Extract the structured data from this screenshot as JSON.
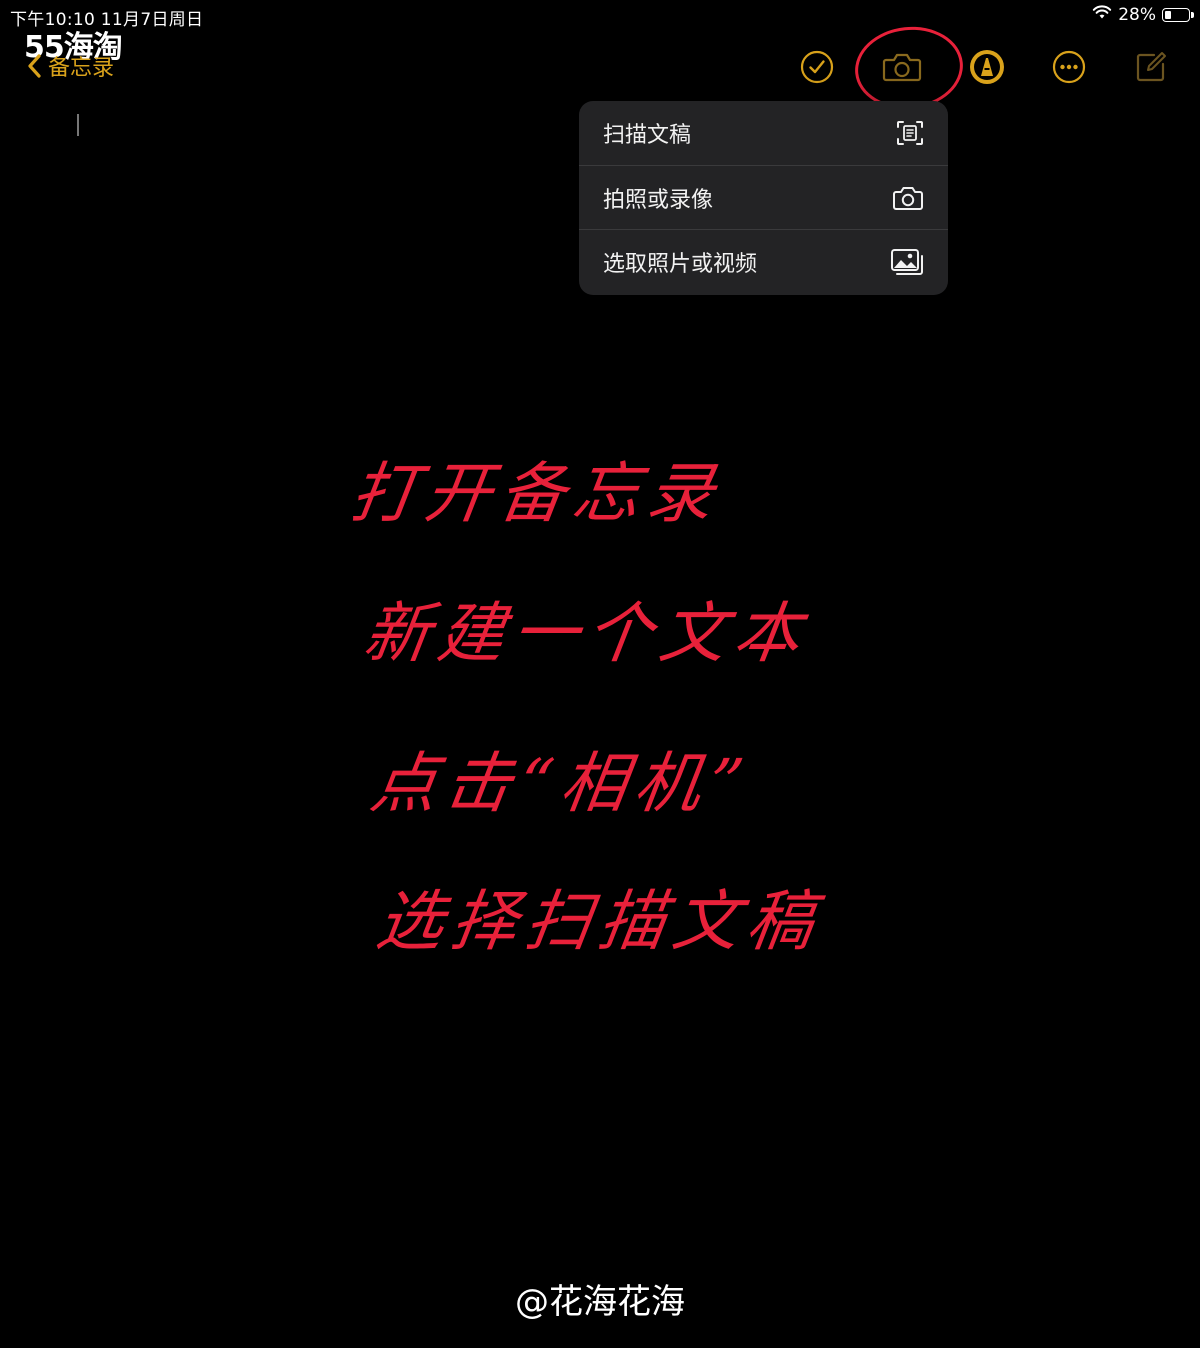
{
  "status_bar": {
    "time": "下午10:10   11月7日周日",
    "battery": "28%",
    "battery_level": 0.28
  },
  "watermark": {
    "logo": "55海淘",
    "credit": "@花海花海"
  },
  "nav": {
    "back_label": "备忘录"
  },
  "toolbar": {
    "icons": [
      "checklist-icon",
      "camera-icon",
      "markup-icon",
      "more-icon",
      "compose-icon"
    ]
  },
  "camera_menu": {
    "items": [
      {
        "label": "扫描文稿",
        "icon": "scan-document-icon"
      },
      {
        "label": "拍照或录像",
        "icon": "camera-icon"
      },
      {
        "label": "选取照片或视频",
        "icon": "photo-library-icon"
      }
    ]
  },
  "annotations": {
    "lines": [
      "打开备忘录",
      "新建一个文本",
      "点击“相机”",
      "选择扫描文稿"
    ]
  },
  "colors": {
    "accent": "#d9a21b",
    "annotation": "#e8213a",
    "menu_bg": "#232325",
    "background": "#000000"
  }
}
